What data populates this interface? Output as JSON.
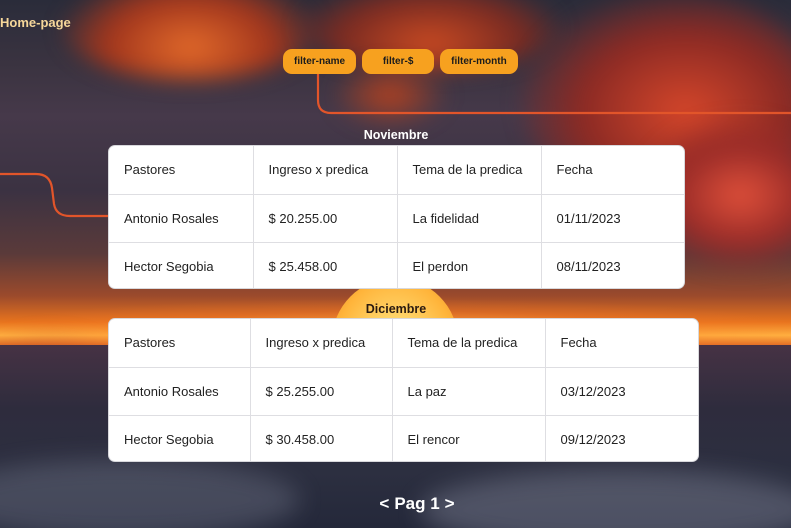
{
  "header": {
    "home_link": "Home-page",
    "filters": [
      {
        "label": "filter-name"
      },
      {
        "label": "filter-$"
      },
      {
        "label": "filter-month"
      }
    ]
  },
  "colors": {
    "filter_button": "#f7a11f",
    "home_link": "#f6d79a",
    "connector_line": "#e2552a",
    "card_background": "#ffffff"
  },
  "tables": [
    {
      "month": "Noviembre",
      "headers": [
        "Pastores",
        "Ingreso x predica",
        "Tema de la predica",
        "Fecha"
      ],
      "rows": [
        [
          "Antonio Rosales",
          "$ 20.255.00",
          "La fidelidad",
          "01/11/2023"
        ],
        [
          "Hector Segobia",
          "$ 25.458.00",
          "El perdon",
          "08/11/2023"
        ]
      ]
    },
    {
      "month": "Diciembre",
      "headers": [
        "Pastores",
        "Ingreso x predica",
        "Tema de la predica",
        "Fecha"
      ],
      "rows": [
        [
          "Antonio Rosales",
          "$ 25.255.00",
          "La paz",
          "03/12/2023"
        ],
        [
          "Hector Segobia",
          "$ 30.458.00",
          "El rencor",
          "09/12/2023"
        ]
      ]
    }
  ],
  "pager": {
    "prev": "<",
    "label": "Pag 1",
    "next": ">"
  }
}
